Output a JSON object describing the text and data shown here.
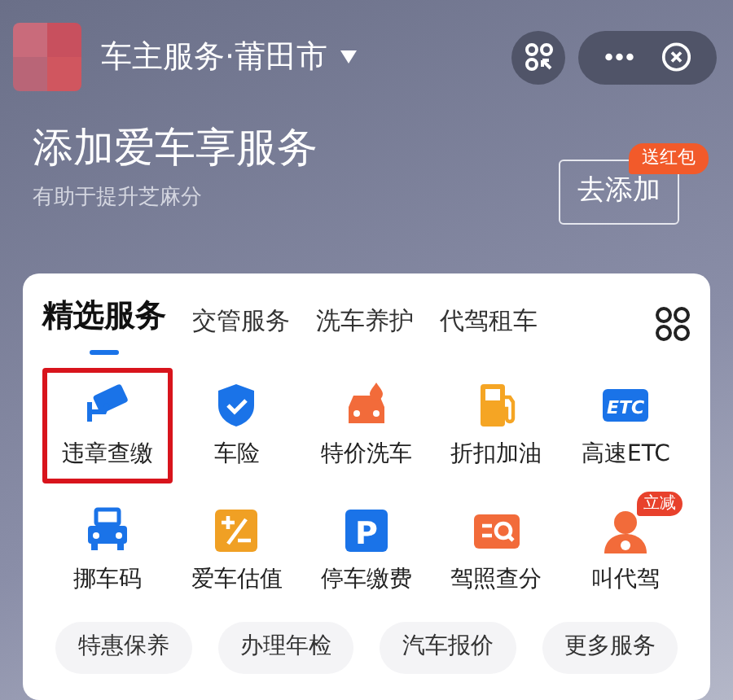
{
  "header": {
    "title": "车主服务·莆田市"
  },
  "promo": {
    "heading": "添加爱车享服务",
    "subtitle": "有助于提升芝麻分",
    "button": "去添加",
    "badge": "送红包"
  },
  "tabs": [
    {
      "label": "精选服务",
      "selected": true
    },
    {
      "label": "交管服务",
      "selected": false
    },
    {
      "label": "洗车养护",
      "selected": false
    },
    {
      "label": "代驾租车",
      "selected": false
    }
  ],
  "services": [
    {
      "label": "违章查缴",
      "color": "#1a73e8",
      "highlighted": true
    },
    {
      "label": "车险",
      "color": "#1a73e8",
      "highlighted": false
    },
    {
      "label": "特价洗车",
      "color": "#f26b3a",
      "highlighted": false
    },
    {
      "label": "折扣加油",
      "color": "#f5a524",
      "highlighted": false
    },
    {
      "label": "高速ETC",
      "color": "#1a73e8",
      "highlighted": false,
      "icon_text": "ETC"
    },
    {
      "label": "挪车码",
      "color": "#1a73e8",
      "highlighted": false
    },
    {
      "label": "爱车估值",
      "color": "#f0a024",
      "highlighted": false
    },
    {
      "label": "停车缴费",
      "color": "#1a73e8",
      "highlighted": false,
      "icon_text": "P"
    },
    {
      "label": "驾照查分",
      "color": "#f26b3a",
      "highlighted": false
    },
    {
      "label": "叫代驾",
      "color": "#f26b3a",
      "highlighted": false,
      "badge": "立减"
    }
  ],
  "pills": [
    "特惠保养",
    "办理年检",
    "汽车报价",
    "更多服务"
  ]
}
